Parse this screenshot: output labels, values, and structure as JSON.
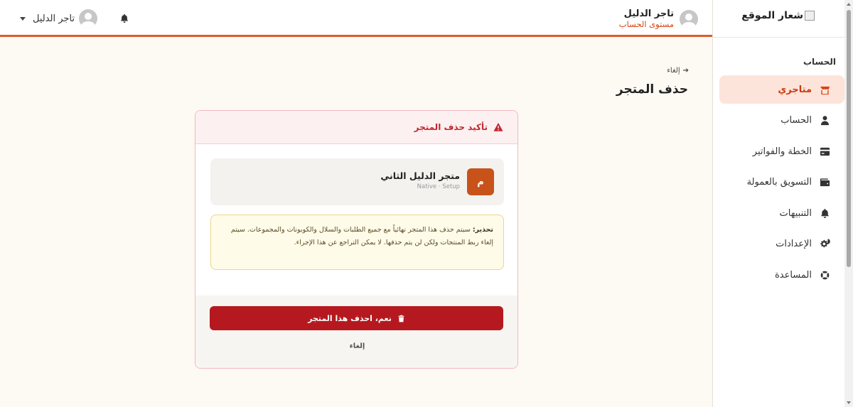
{
  "sidebar": {
    "logo_text": "شعار الموقع",
    "section_title": "الحساب",
    "items": [
      {
        "label": "متاجري",
        "icon": "store-icon",
        "active": true
      },
      {
        "label": "الحساب",
        "icon": "user-icon",
        "active": false
      },
      {
        "label": "الخطة والفواتير",
        "icon": "credit-card-icon",
        "active": false
      },
      {
        "label": "التسويق بالعمولة",
        "icon": "wallet-icon",
        "active": false
      },
      {
        "label": "التنبيهات",
        "icon": "bell-icon",
        "active": false
      },
      {
        "label": "الإعدادات",
        "icon": "gears-icon",
        "active": false
      },
      {
        "label": "المساعدة",
        "icon": "life-ring-icon",
        "active": false
      }
    ]
  },
  "header": {
    "account_name": "تاجر الدليل",
    "account_level": "مستوى الحساب",
    "user_menu_name": "تاجر الدليل",
    "accent_color": "#e15a2a"
  },
  "page": {
    "back_label": "إلغاء",
    "title": "حذف المتجر"
  },
  "card": {
    "header_title": "تأكيد حذف المتجر",
    "store": {
      "badge": "م",
      "name": "متجر الدليل الثاني",
      "meta": "Native · Setup"
    },
    "warning_label": "تحذير:",
    "warning_text": " سيتم حذف هذا المتجر نهائياً مع جميع الطلبات والسلال والكوبونات والمجموعات. سيتم إلغاء ربط المنتجات ولكن لن يتم حذفها. لا يمكن التراجع عن هذا الإجراء.",
    "delete_label": "نعم، احذف هذا المتجر",
    "cancel_label": "إلغاء",
    "danger_color": "#b5191f"
  }
}
